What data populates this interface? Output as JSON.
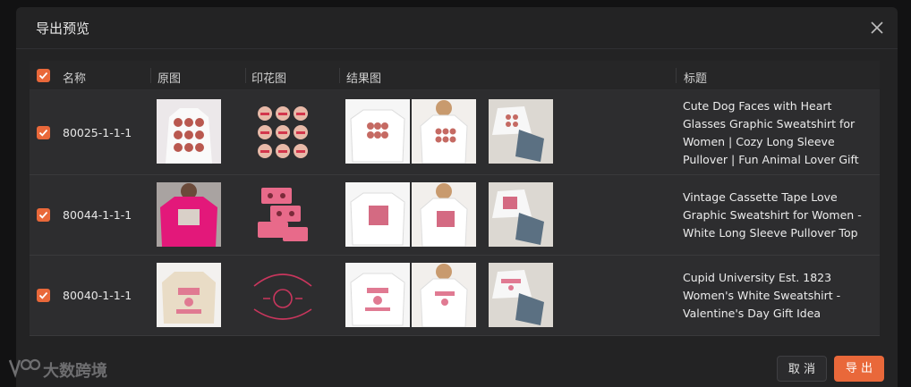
{
  "dialog": {
    "title": "导出预览",
    "columns": {
      "name": "名称",
      "original": "原图",
      "print": "印花图",
      "result": "结果图",
      "title": "标题"
    },
    "rows": [
      {
        "name": "80025-1-1-1",
        "title": "Cute Dog Faces with Heart Glasses Graphic Sweatshirt for Women | Cozy Long Sleeve Pullover | Fun Animal Lover Gift"
      },
      {
        "name": "80044-1-1-1",
        "title": "Vintage Cassette Tape Love Graphic Sweatshirt for Women - White Long Sleeve Pullover Top"
      },
      {
        "name": "80040-1-1-1",
        "title": "Cupid University Est. 1823 Women's White Sweatshirt - Valentine's Day Gift Idea"
      }
    ],
    "buttons": {
      "cancel": "取 消",
      "export": "导 出"
    }
  },
  "watermark": {
    "text": "大数跨境"
  },
  "colors": {
    "accent": "#e9683a",
    "dialog_bg": "#232324",
    "row_bg": "#2d2d2f",
    "print_pink": "#c9365d"
  },
  "icons": {
    "close": "close-icon",
    "checkbox": "check-icon"
  }
}
